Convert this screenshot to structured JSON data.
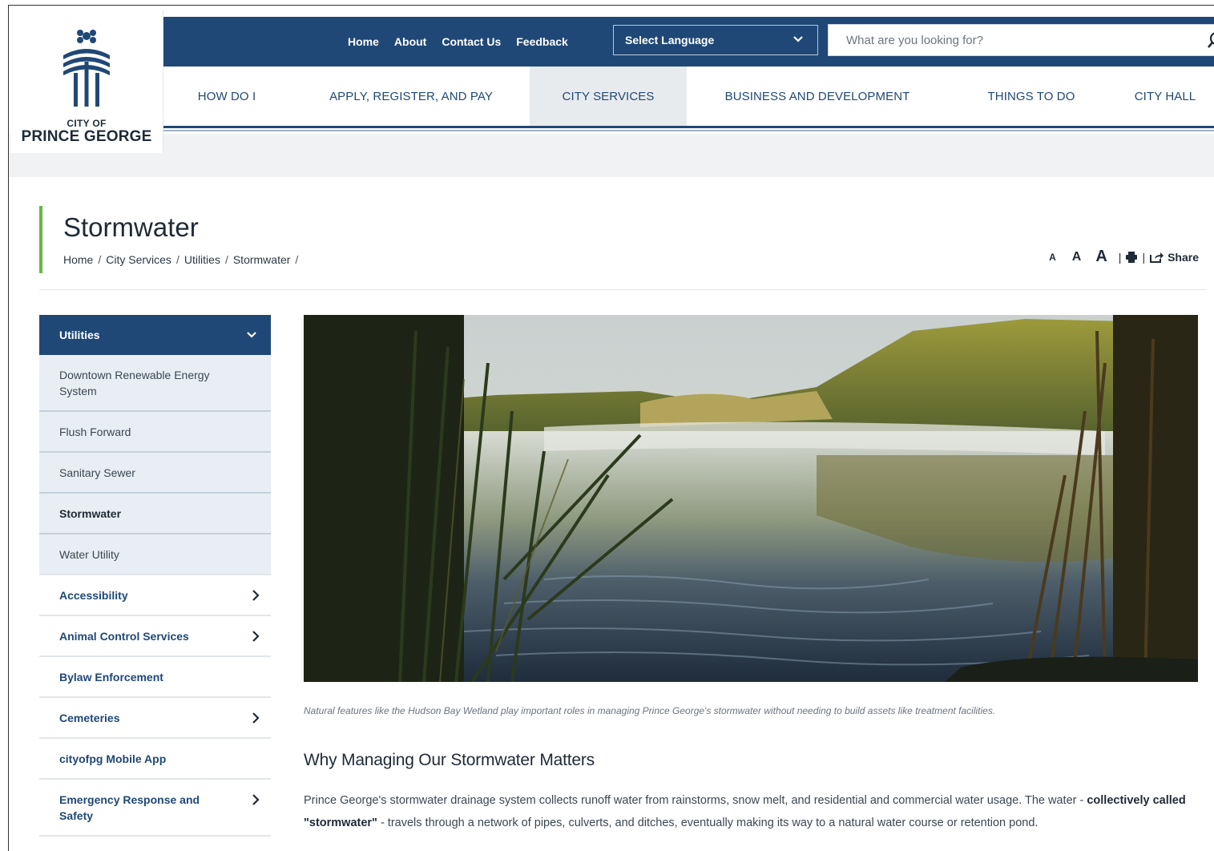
{
  "logo": {
    "line1": "CITY OF",
    "line2": "PRINCE GEORGE"
  },
  "topbar": {
    "links": [
      "Home",
      "About",
      "Contact Us",
      "Feedback"
    ],
    "language_label": "Select Language",
    "search_placeholder": "What are you looking for?"
  },
  "mainnav": [
    "HOW DO I",
    "APPLY, REGISTER, AND PAY",
    "CITY SERVICES",
    "BUSINESS AND DEVELOPMENT",
    "THINGS TO DO",
    "CITY HALL"
  ],
  "page": {
    "title": "Stormwater",
    "breadcrumbs": [
      "Home",
      "City Services",
      "Utilities",
      "Stormwater"
    ],
    "tools": {
      "a_small": "A",
      "a_medium": "A",
      "a_large": "A",
      "share": "Share"
    }
  },
  "sidebar": {
    "header": "Utilities",
    "sub_items": [
      "Downtown Renewable Energy System",
      "Flush Forward",
      "Sanitary Sewer",
      "Stormwater",
      "Water Utility"
    ],
    "items": [
      "Accessibility",
      "Animal Control Services",
      "Bylaw Enforcement",
      "Cemeteries",
      "cityofpg Mobile App",
      "Emergency Response and Safety"
    ]
  },
  "content": {
    "caption": "Natural features like the Hudson Bay Wetland play important roles in managing Prince George's stormwater without needing to build assets like treatment facilities.",
    "heading": "Why Managing Our Stormwater Matters",
    "para_start": "Prince George's stormwater drainage system collects runoff water from rainstorms, snow melt, and residential and commercial water usage. The water - ",
    "para_bold": "collectively called \"stormwater\"",
    "para_end": " - travels through a network of pipes, culverts, and ditches, eventually making its way to a natural water course or retention pond."
  },
  "colors": {
    "navy": "#1f4876",
    "accent_green": "#6ab548",
    "sidebar_sub_bg": "#e9eef4"
  },
  "icons": [
    "city-logo-icon",
    "chevron-down-icon",
    "search-icon",
    "print-icon",
    "share-icon",
    "chevron-right-icon"
  ]
}
